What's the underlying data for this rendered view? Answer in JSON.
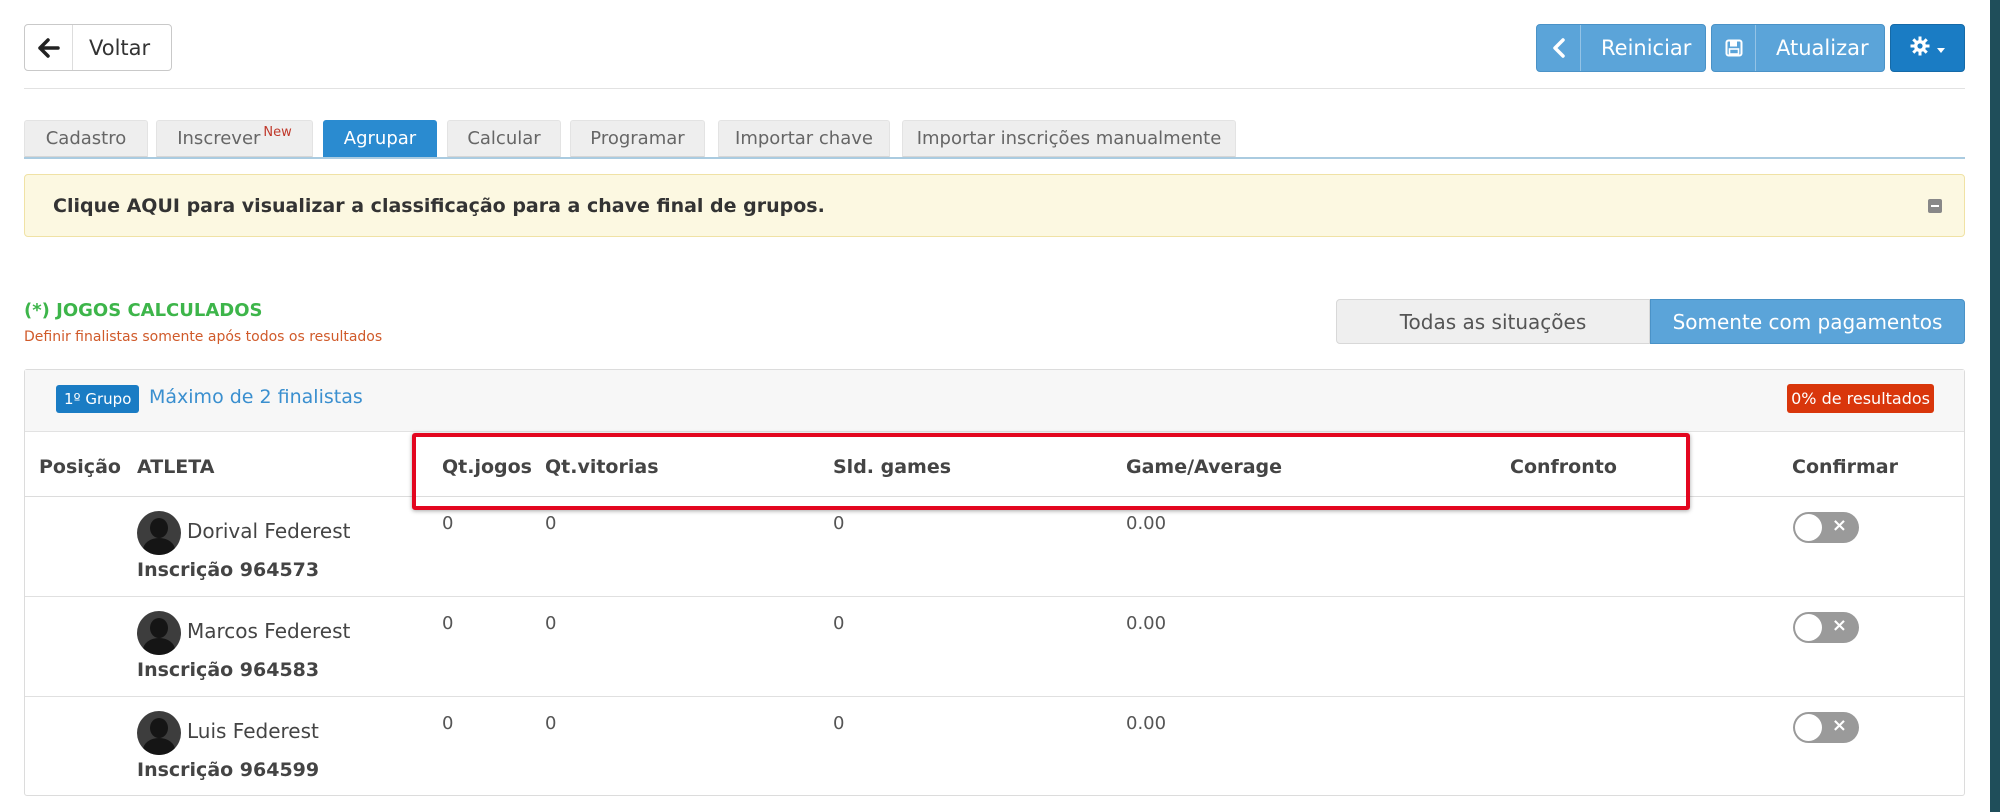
{
  "header": {
    "back_label": "Voltar",
    "reiniciar_label": "Reiniciar",
    "atualizar_label": "Atualizar"
  },
  "tabs": [
    {
      "label": "Cadastro"
    },
    {
      "label": "Inscrever",
      "badge": "New"
    },
    {
      "label": "Agrupar",
      "active": true
    },
    {
      "label": "Calcular"
    },
    {
      "label": "Programar"
    },
    {
      "label": "Importar chave"
    },
    {
      "label": "Importar inscrições manualmente"
    }
  ],
  "alert": {
    "text": "Clique AQUI para visualizar a classificação para a chave final de grupos."
  },
  "calculated": {
    "title": "(*) JOGOS CALCULADOS",
    "subtitle": "Definir finalistas somente após todos os resultados"
  },
  "filters": {
    "all": "Todas as situações",
    "paid": "Somente com pagamentos"
  },
  "group": {
    "badge": "1º Grupo",
    "max_finalists": "Máximo de 2 finalistas",
    "results_badge": "0% de resultados",
    "columns": {
      "position": "Posição",
      "athlete": "ATLETA",
      "games": "Qt.jogos",
      "wins": "Qt.vitorias",
      "balance": "Sld. games",
      "average": "Game/Average",
      "match": "Confronto",
      "confirm": "Confirmar"
    },
    "rows": [
      {
        "name": "Dorival Federest",
        "inscricao": "Inscrição 964573",
        "games": "0",
        "wins": "0",
        "balance": "0",
        "average": "0.00",
        "confirmed": false
      },
      {
        "name": "Marcos Federest",
        "inscricao": "Inscrição 964583",
        "games": "0",
        "wins": "0",
        "balance": "0",
        "average": "0.00",
        "confirmed": false
      },
      {
        "name": "Luis Federest",
        "inscricao": "Inscrição 964599",
        "games": "0",
        "wins": "0",
        "balance": "0",
        "average": "0.00",
        "confirmed": false
      }
    ]
  },
  "colors": {
    "primary": "#1a7cc4",
    "primary_light": "#5ba4d9",
    "success_text": "#3db54a",
    "warning_bg": "#fcf8e1",
    "danger": "#d9360b",
    "highlight": "#e3061f"
  },
  "icons": {
    "back": "arrow-left-icon",
    "reiniciar": "chevron-left-icon",
    "atualizar": "floppy-disk-icon",
    "settings": "gear-icon",
    "collapse": "minus-square-icon",
    "avatar": "user-avatar-icon",
    "toggle_off": "close-icon"
  }
}
